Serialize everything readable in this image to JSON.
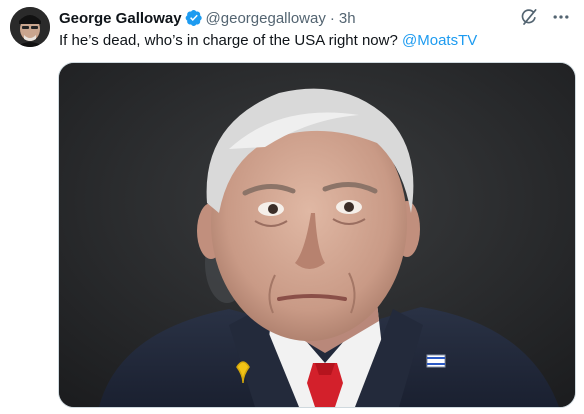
{
  "tweet": {
    "author": {
      "display_name": "George Galloway",
      "handle": "@georgegalloway",
      "verified": true
    },
    "separator": "·",
    "time": "3h",
    "text": "If he’s dead, who’s in charge of the USA right now? ",
    "mention": "@MoatsTV",
    "icons": {
      "grok": "grok-icon",
      "more": "more-icon",
      "verified": "verified-badge-icon"
    },
    "colors": {
      "accent": "#1d9bf0",
      "secondary_text": "#536471",
      "primary_text": "#0f1419"
    }
  }
}
